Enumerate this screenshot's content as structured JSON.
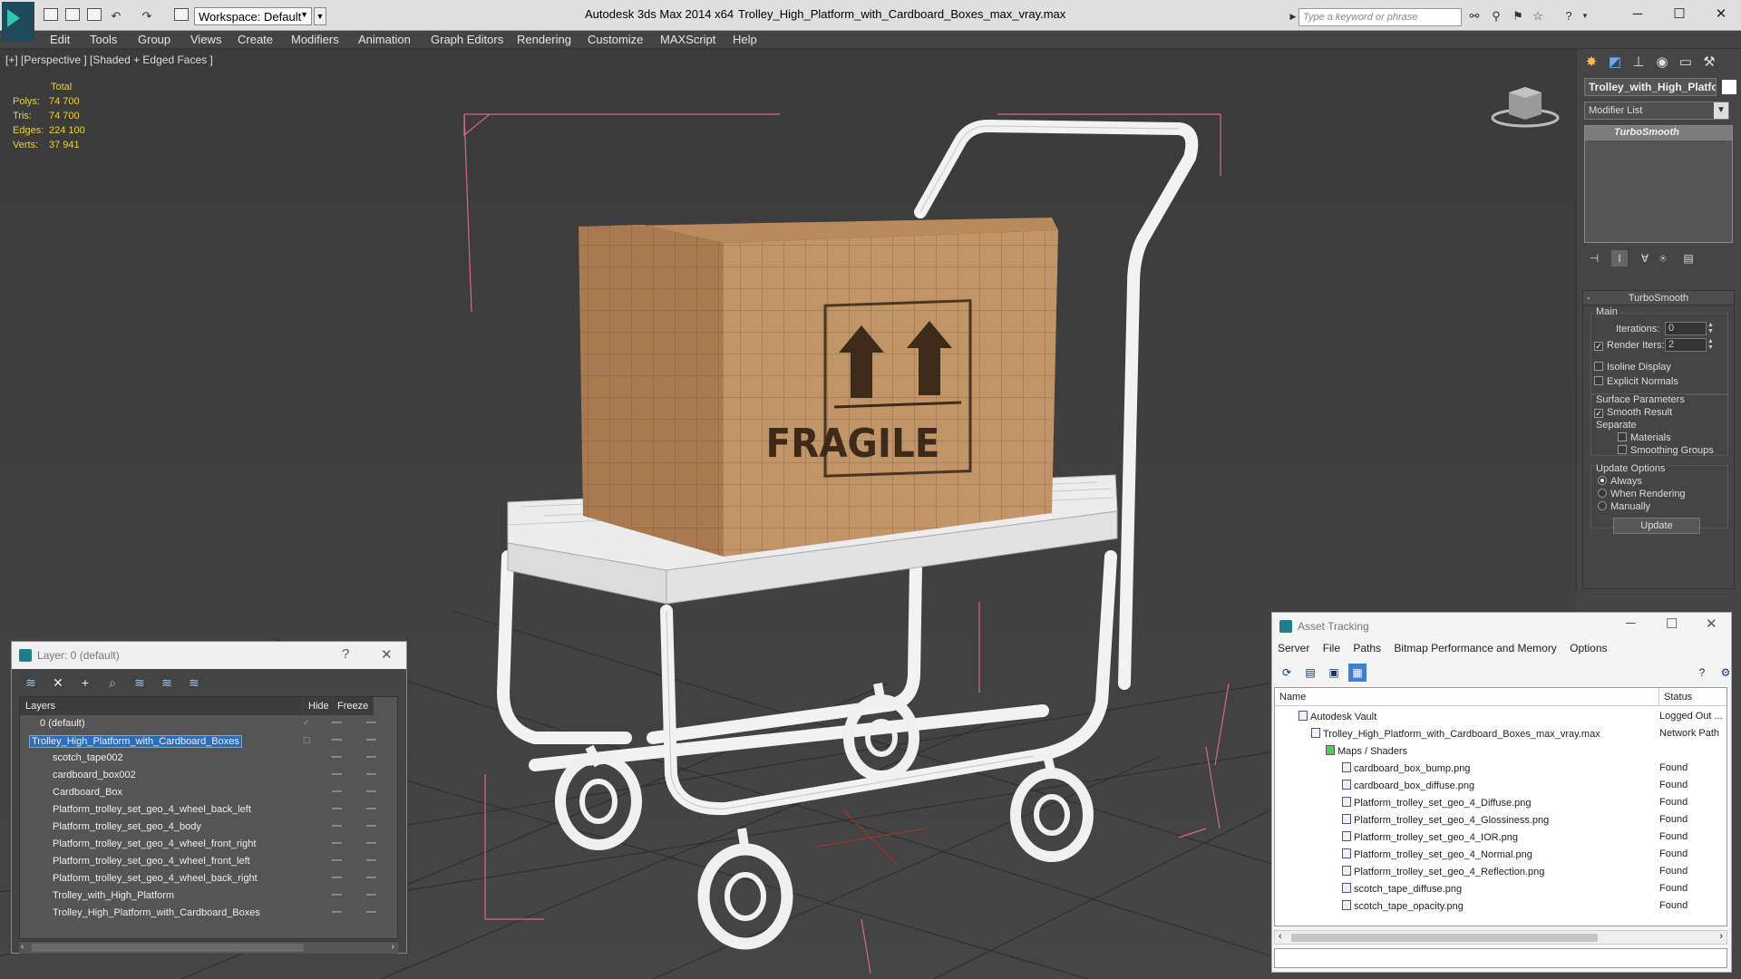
{
  "titlebar": {
    "workspace": "Workspace: Default",
    "app_title": "Autodesk 3ds Max  2014 x64",
    "doc_title": "Trolley_High_Platform_with_Cardboard_Boxes_max_vray.max",
    "search_placeholder": "Type a keyword or phrase"
  },
  "menu": [
    "Edit",
    "Tools",
    "Group",
    "Views",
    "Create",
    "Modifiers",
    "Animation",
    "Graph Editors",
    "Rendering",
    "Customize",
    "MAXScript",
    "Help"
  ],
  "viewport": {
    "label": "[+] [Perspective ] [Shaded + Edged Faces ]",
    "stats_header": "Total",
    "stats": [
      {
        "label": "Polys:",
        "value": "74 700"
      },
      {
        "label": "Tris:",
        "value": "74 700"
      },
      {
        "label": "Edges:",
        "value": "224 100"
      },
      {
        "label": "Verts:",
        "value": "37 941"
      }
    ],
    "box_label": "FRAGILE"
  },
  "command_panel": {
    "object_name": "Trolley_with_High_Platfo",
    "modifier_list": "Modifier List",
    "stack_item": "TurboSmooth",
    "rollout_title": "TurboSmooth",
    "main_label": "Main",
    "iterations_label": "Iterations:",
    "iterations_value": "0",
    "render_iters_label": "Render Iters:",
    "render_iters_value": "2",
    "isoline": "Isoline Display",
    "explicit_normals": "Explicit Normals",
    "surface_params": "Surface Parameters",
    "smooth_result": "Smooth Result",
    "separate": "Separate",
    "materials": "Materials",
    "smoothing_groups": "Smoothing Groups",
    "update_options": "Update Options",
    "always": "Always",
    "when_rendering": "When Rendering",
    "manually": "Manually",
    "update_button": "Update"
  },
  "layer_dialog": {
    "title": "Layer: 0 (default)",
    "col_layers": "Layers",
    "col_hide": "Hide",
    "col_freeze": "Freeze",
    "rows": [
      {
        "name": "0 (default)"
      },
      {
        "name": "Trolley_High_Platform_with_Cardboard_Boxes"
      },
      {
        "name": "scotch_tape002"
      },
      {
        "name": "cardboard_box002"
      },
      {
        "name": "Cardboard_Box"
      },
      {
        "name": "Platform_trolley_set_geo_4_wheel_back_left"
      },
      {
        "name": "Platform_trolley_set_geo_4_body"
      },
      {
        "name": "Platform_trolley_set_geo_4_wheel_front_right"
      },
      {
        "name": "Platform_trolley_set_geo_4_wheel_front_left"
      },
      {
        "name": "Platform_trolley_set_geo_4_wheel_back_right"
      },
      {
        "name": "Trolley_with_High_Platform"
      },
      {
        "name": "Trolley_High_Platform_with_Cardboard_Boxes"
      }
    ]
  },
  "asset_dialog": {
    "title": "Asset Tracking",
    "menu": [
      "Server",
      "File",
      "Paths",
      "Bitmap Performance and Memory",
      "Options"
    ],
    "col_name": "Name",
    "col_status": "Status",
    "rows": [
      {
        "name": "Autodesk Vault",
        "status": "Logged Out ..."
      },
      {
        "name": "Trolley_High_Platform_with_Cardboard_Boxes_max_vray.max",
        "status": "Network Path"
      },
      {
        "name": "Maps / Shaders",
        "status": ""
      },
      {
        "name": "cardboard_box_bump.png",
        "status": "Found"
      },
      {
        "name": "cardboard_box_diffuse.png",
        "status": "Found"
      },
      {
        "name": "Platform_trolley_set_geo_4_Diffuse.png",
        "status": "Found"
      },
      {
        "name": "Platform_trolley_set_geo_4_Glossiness.png",
        "status": "Found"
      },
      {
        "name": "Platform_trolley_set_geo_4_IOR.png",
        "status": "Found"
      },
      {
        "name": "Platform_trolley_set_geo_4_Normal.png",
        "status": "Found"
      },
      {
        "name": "Platform_trolley_set_geo_4_Reflection.png",
        "status": "Found"
      },
      {
        "name": "scotch_tape_diffuse.png",
        "status": "Found"
      },
      {
        "name": "scotch_tape_opacity.png",
        "status": "Found"
      }
    ]
  },
  "colors": {
    "stats_yellow": "#e8d23a",
    "selection_blue": "#2a6ebf",
    "app_teal": "#1f7d8c",
    "box_brown": "#b98a5c"
  }
}
